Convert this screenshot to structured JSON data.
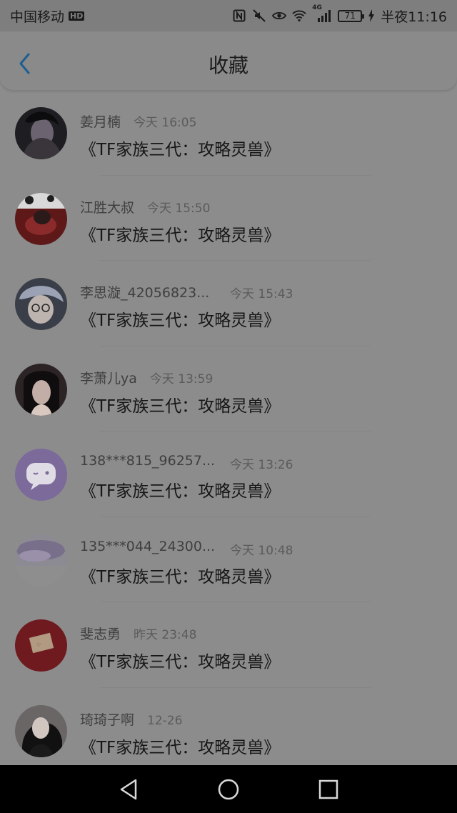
{
  "status_bar": {
    "carrier": "中国移动",
    "hd_badge": "HD",
    "network": "4G",
    "battery": "71",
    "time": "半夜11:16"
  },
  "header": {
    "title": "收藏"
  },
  "items": [
    {
      "name": "姜月楠",
      "time": "今天 16:05",
      "title": "《TF家族三代：攻略灵兽》",
      "avatar_color": "#2a2a2a"
    },
    {
      "name": "江胜大叔",
      "time": "今天 15:50",
      "title": "《TF家族三代：攻略灵兽》",
      "avatar_color": "#6a1c1c"
    },
    {
      "name": "李思漩_42056823...",
      "time": "今天 15:43",
      "title": "《TF家族三代：攻略灵兽》",
      "avatar_color": "#4a4f5a"
    },
    {
      "name": "李萧儿ya",
      "time": "今天 13:59",
      "title": "《TF家族三代：攻略灵兽》",
      "avatar_color": "#3a2b2b"
    },
    {
      "name": "138***815_96257...",
      "time": "今天 13:26",
      "title": "《TF家族三代：攻略灵兽》",
      "avatar_color": "#7b6a9a"
    },
    {
      "name": "135***044_24300...",
      "time": "今天 10:48",
      "title": "《TF家族三代：攻略灵兽》",
      "avatar_color": "#8a8494"
    },
    {
      "name": "斐志勇",
      "time": "昨天 23:48",
      "title": "《TF家族三代：攻略灵兽》",
      "avatar_color": "#6e1a1f"
    },
    {
      "name": "琦琦子啊",
      "time": "12-26",
      "title": "《TF家族三代：攻略灵兽》",
      "avatar_color": "#262626"
    }
  ]
}
